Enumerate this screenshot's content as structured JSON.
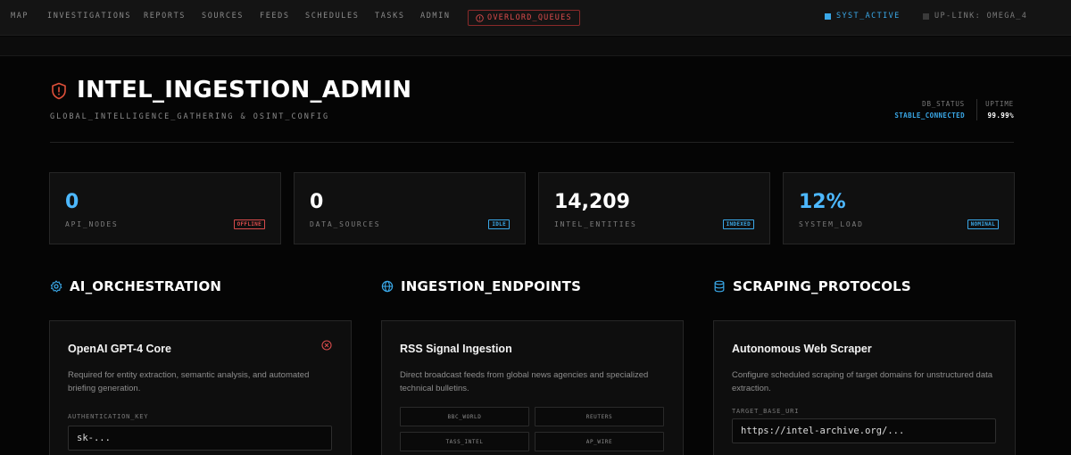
{
  "nav": {
    "items": [
      "MAP",
      "INVESTIGATIONS",
      "REPORTS",
      "SOURCES",
      "FEEDS",
      "SCHEDULES",
      "TASKS",
      "ADMIN"
    ],
    "alert_label": "OVERLORD_QUEUES",
    "system_status": "SYST_ACTIVE",
    "uplink": "UP-LINK: OMEGA_4"
  },
  "header": {
    "title": "INTEL_INGESTION_ADMIN",
    "subtitle": "GLOBAL_INTELLIGENCE_GATHERING & OSINT_CONFIG",
    "db_status_label": "DB_STATUS",
    "db_status_value": "STABLE_CONNECTED",
    "uptime_label": "UPTIME",
    "uptime_value": "99.99%"
  },
  "stats": [
    {
      "value": "0",
      "label": "API_NODES",
      "badge": "OFFLINE",
      "color": "#4db8ff",
      "badge_color": "#d84b4b"
    },
    {
      "value": "0",
      "label": "DATA_SOURCES",
      "badge": "IDLE",
      "color": "#ffffff",
      "badge_color": "#3aa8e8"
    },
    {
      "value": "14,209",
      "label": "INTEL_ENTITIES",
      "badge": "INDEXED",
      "color": "#ffffff",
      "badge_color": "#3aa8e8"
    },
    {
      "value": "12%",
      "label": "SYSTEM_LOAD",
      "badge": "NOMINAL",
      "color": "#4db8ff",
      "badge_color": "#3aa8e8"
    }
  ],
  "sections": {
    "ai": {
      "title": "AI_ORCHESTRATION",
      "panel_title": "OpenAI GPT-4 Core",
      "panel_desc": "Required for entity extraction, semantic analysis, and automated briefing generation.",
      "field_label": "AUTHENTICATION_KEY",
      "field_value": "sk-..."
    },
    "ingestion": {
      "title": "INGESTION_ENDPOINTS",
      "panel_title": "RSS Signal Ingestion",
      "panel_desc": "Direct broadcast feeds from global news agencies and specialized technical bulletins.",
      "chips": [
        "BBC_WORLD",
        "REUTERS",
        "TASS_INTEL",
        "AP_WIRE"
      ]
    },
    "scraping": {
      "title": "SCRAPING_PROTOCOLS",
      "panel_title": "Autonomous Web Scraper",
      "panel_desc": "Configure scheduled scraping of target domains for unstructured data extraction.",
      "field_label": "TARGET_BASE_URI",
      "field_value": "https://intel-archive.org/..."
    }
  },
  "colors": {
    "accent": "#3aa8e8",
    "alert": "#d84b4b",
    "stat_blue": "#4db8ff"
  }
}
